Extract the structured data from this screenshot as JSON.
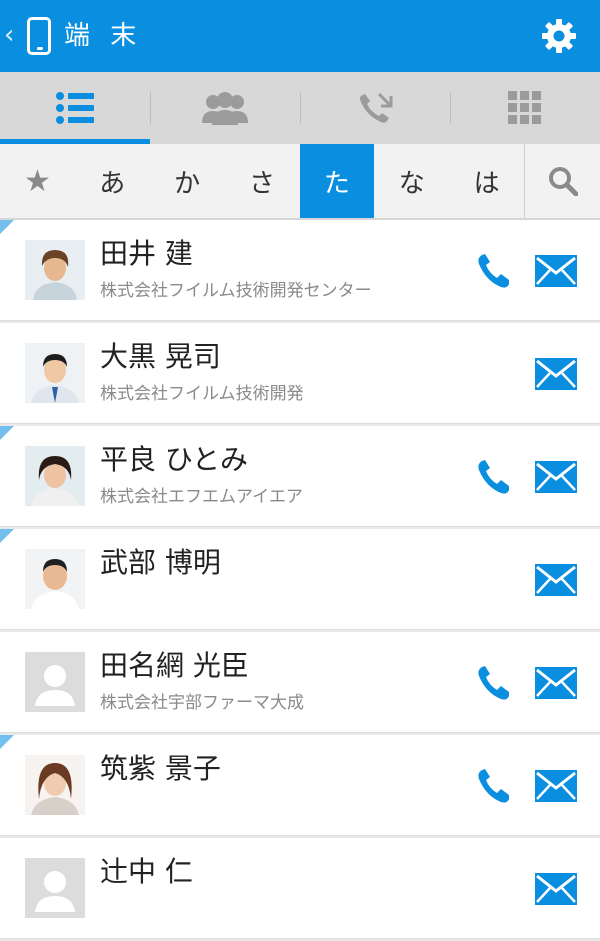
{
  "header": {
    "back_glyph": "‹",
    "title": "端 末",
    "icons": [
      "device-icon",
      "gear-icon"
    ]
  },
  "tabs": [
    {
      "icon": "list-icon",
      "active": true
    },
    {
      "icon": "group-icon",
      "active": false
    },
    {
      "icon": "call-log-icon",
      "active": false
    },
    {
      "icon": "grid-icon",
      "active": false
    }
  ],
  "index": {
    "star": "★",
    "letters": [
      "あ",
      "か",
      "さ",
      "た",
      "な",
      "は"
    ],
    "active": "た",
    "search_icon": "search-icon"
  },
  "colors": {
    "accent": "#0a8ee0",
    "flag": "#73c0ef",
    "header_text": "#ffffff"
  },
  "contacts": [
    {
      "name": "田井 建",
      "company": "株式会社フイルム技術開発センター",
      "phone": true,
      "mail": true,
      "flag": true
    },
    {
      "name": "大黒 晃司",
      "company": "株式会社フイルム技術開発",
      "phone": false,
      "mail": true,
      "flag": false
    },
    {
      "name": "平良 ひとみ",
      "company": "株式会社エフエムアイエア",
      "phone": true,
      "mail": true,
      "flag": true
    },
    {
      "name": "武部 博明",
      "company": "",
      "phone": false,
      "mail": true,
      "flag": true
    },
    {
      "name": "田名網 光臣",
      "company": "株式会社宇部ファーマ大成",
      "phone": true,
      "mail": true,
      "flag": false
    },
    {
      "name": "筑紫 景子",
      "company": "",
      "phone": true,
      "mail": true,
      "flag": true
    },
    {
      "name": "辻中 仁",
      "company": "",
      "phone": false,
      "mail": true,
      "flag": false
    }
  ]
}
